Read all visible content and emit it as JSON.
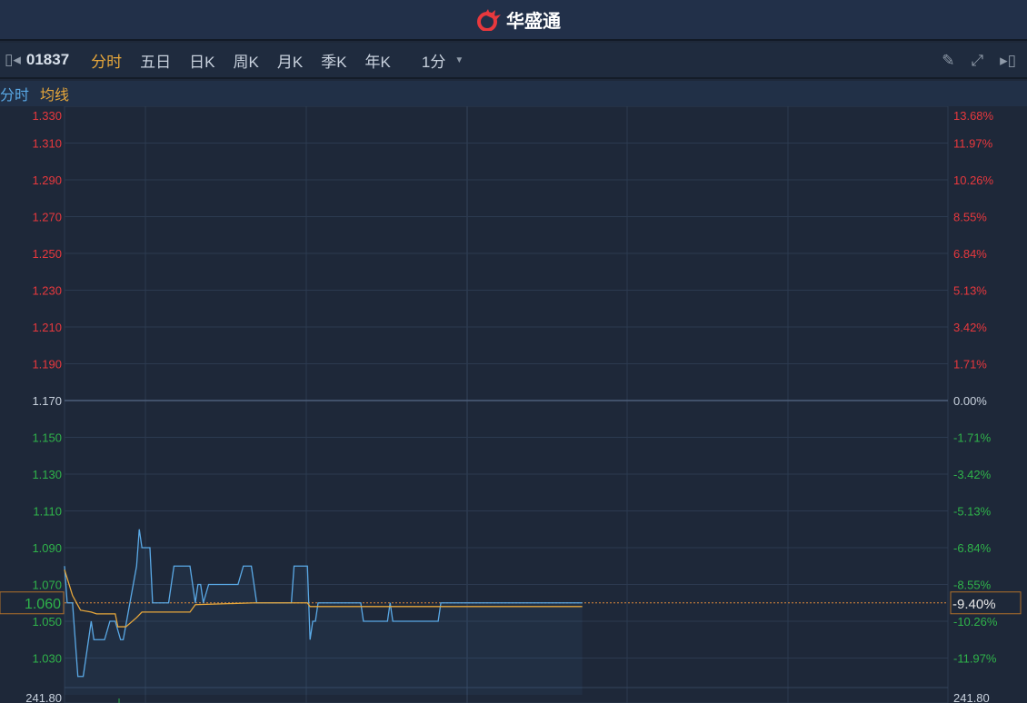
{
  "title": {
    "brand": "华盛通"
  },
  "toolbar": {
    "code": "01837",
    "tabs": [
      "分时",
      "五日",
      "日K",
      "周K",
      "月K",
      "季K",
      "年K"
    ],
    "active_tab": "分时",
    "interval": "1分"
  },
  "legend": {
    "price": "分时",
    "avg": "均线"
  },
  "colors": {
    "up": "#e8383d",
    "down": "#2fb34a",
    "flat": "#c9d2de",
    "price_line": "#5aa9e6",
    "avg_line": "#e7a73b",
    "grid": "#2c3a50"
  },
  "chart_data": {
    "type": "line",
    "prev_close": 1.17,
    "ylim": [
      1.01,
      1.33
    ],
    "y_ticks_left": [
      "1.330",
      "1.310",
      "1.290",
      "1.270",
      "1.250",
      "1.230",
      "1.210",
      "1.190",
      "1.170",
      "1.150",
      "1.130",
      "1.110",
      "1.090",
      "1.070",
      "1.050",
      "1.030"
    ],
    "y_ticks_right": [
      "13.68%",
      "11.97%",
      "10.26%",
      "8.55%",
      "6.84%",
      "5.13%",
      "3.42%",
      "1.71%",
      "0.00%",
      "-1.71%",
      "-3.42%",
      "-5.13%",
      "-6.84%",
      "-8.55%",
      "-10.26%",
      "-11.97%"
    ],
    "total_minutes": 331,
    "current_price": "1.060",
    "current_pct": "-9.40%",
    "volume_label_left": "241.80",
    "volume_label_right": "241.80",
    "series": [
      {
        "name": "分时",
        "points": [
          [
            0,
            1.08
          ],
          [
            1,
            1.06
          ],
          [
            3,
            1.06
          ],
          [
            5,
            1.02
          ],
          [
            7,
            1.02
          ],
          [
            10,
            1.05
          ],
          [
            11,
            1.04
          ],
          [
            15,
            1.04
          ],
          [
            17,
            1.05
          ],
          [
            19,
            1.05
          ],
          [
            21,
            1.04
          ],
          [
            22,
            1.04
          ],
          [
            27,
            1.08
          ],
          [
            28,
            1.1
          ],
          [
            29,
            1.09
          ],
          [
            32,
            1.09
          ],
          [
            33,
            1.06
          ],
          [
            39,
            1.06
          ],
          [
            41,
            1.08
          ],
          [
            47,
            1.08
          ],
          [
            49,
            1.06
          ],
          [
            50,
            1.07
          ],
          [
            51,
            1.07
          ],
          [
            52,
            1.06
          ],
          [
            54,
            1.07
          ],
          [
            65,
            1.07
          ],
          [
            67,
            1.08
          ],
          [
            70,
            1.08
          ],
          [
            72,
            1.06
          ],
          [
            85,
            1.06
          ],
          [
            86,
            1.08
          ],
          [
            91,
            1.08
          ],
          [
            92,
            1.04
          ],
          [
            93,
            1.05
          ],
          [
            94,
            1.05
          ],
          [
            95,
            1.06
          ],
          [
            111,
            1.06
          ],
          [
            112,
            1.05
          ],
          [
            121,
            1.05
          ],
          [
            122,
            1.06
          ],
          [
            123,
            1.05
          ],
          [
            140,
            1.05
          ],
          [
            141,
            1.06
          ],
          [
            194,
            1.06
          ]
        ]
      },
      {
        "name": "均线",
        "points": [
          [
            0,
            1.078
          ],
          [
            3,
            1.064
          ],
          [
            6,
            1.056
          ],
          [
            10,
            1.055
          ],
          [
            12,
            1.054
          ],
          [
            19,
            1.054
          ],
          [
            20,
            1.047
          ],
          [
            23,
            1.047
          ],
          [
            27,
            1.052
          ],
          [
            29,
            1.055
          ],
          [
            47,
            1.055
          ],
          [
            49,
            1.059
          ],
          [
            71,
            1.06
          ],
          [
            91,
            1.06
          ],
          [
            92,
            1.058
          ],
          [
            194,
            1.058
          ]
        ]
      }
    ]
  }
}
